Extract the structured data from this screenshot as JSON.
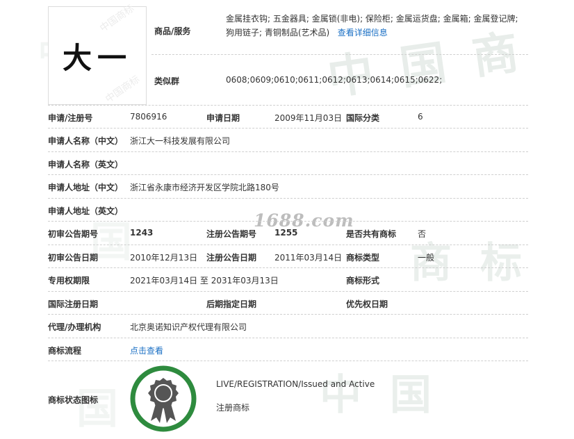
{
  "logo_text": "大一",
  "goods": {
    "label": "商品/服务",
    "value": "金属挂衣钩; 五金器具; 金属锁(非电); 保险柜; 金属运货盘; 金属箱; 金属登记牌; 狗用链子; 青铜制品(艺术品)",
    "link": "查看详细信息"
  },
  "similar_group": {
    "label": "类似群",
    "value": "0608;0609;0610;0611;0612;0613;0614;0615;0622;"
  },
  "rows": {
    "reg_no_label": "申请/注册号",
    "reg_no": "7806916",
    "apply_date_label": "申请日期",
    "apply_date": "2009年11月03日",
    "intl_class_label": "国际分类",
    "intl_class": "6",
    "applicant_cn_label": "申请人名称（中文）",
    "applicant_cn": "浙江大一科技发展有限公司",
    "applicant_en_label": "申请人名称（英文）",
    "applicant_en": "",
    "address_cn_label": "申请人地址（中文）",
    "address_cn": "浙江省永康市经济开发区学院北路180号",
    "address_en_label": "申请人地址（英文）",
    "address_en": "",
    "prelim_no_label": "初审公告期号",
    "prelim_no": "1243",
    "reg_pub_no_label": "注册公告期号",
    "reg_pub_no": "1255",
    "shared_label": "是否共有商标",
    "shared": "否",
    "prelim_date_label": "初审公告日期",
    "prelim_date": "2010年12月13日",
    "reg_pub_date_label": "注册公告日期",
    "reg_pub_date": "2011年03月14日",
    "tm_type_label": "商标类型",
    "tm_type": "一般",
    "exclusive_label": "专用权期限",
    "exclusive": "2021年03月14日 至 2031年03月13日",
    "tm_form_label": "商标形式",
    "tm_form": "",
    "intl_reg_date_label": "国际注册日期",
    "intl_reg_date": "",
    "later_date_label": "后期指定日期",
    "later_date": "",
    "priority_date_label": "优先权日期",
    "priority_date": "",
    "agent_label": "代理/办理机构",
    "agent": "北京奥诺知识产权代理有限公司",
    "flow_label": "商标流程",
    "flow_link": "点击查看",
    "status_icon_label": "商标状态图标",
    "status_en": "LIVE/REGISTRATION/Issued and Active",
    "status_cn": "注册商标"
  },
  "watermarks": {
    "site": "1688.com"
  },
  "colors": {
    "link": "#1a6fc4",
    "seal_ring": "#2e8b3e",
    "seal_badge": "#555555"
  }
}
